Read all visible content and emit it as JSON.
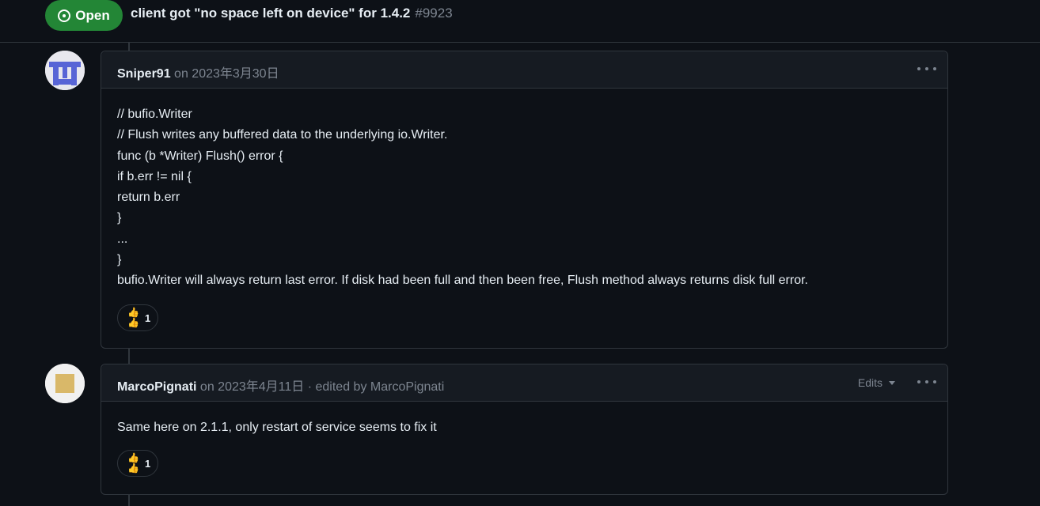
{
  "issue": {
    "state": "Open",
    "title": "client got \"no space left on device\" for 1.4.2",
    "number": "#9923"
  },
  "comments": [
    {
      "author": "Sniper91",
      "date": "on 2023年3月30日",
      "body": [
        "// bufio.Writer",
        "// Flush writes any buffered data to the underlying io.Writer.",
        "func (b *Writer) Flush() error {",
        "if b.err != nil {",
        "return b.err",
        "}",
        "...",
        "}",
        "bufio.Writer will always return last error. If disk had been full and then been free, Flush method always returns disk full error."
      ],
      "reaction": {
        "emoji": "👍",
        "count": "1"
      }
    },
    {
      "author": "MarcoPignati",
      "date": "on 2023年4月11日",
      "edited": "· edited by MarcoPignati",
      "edits_label": "Edits",
      "body": [
        "Same here on 2.1.1, only restart of service seems to fix it"
      ],
      "reaction": {
        "emoji": "👍",
        "count": "1"
      }
    }
  ],
  "colors": {
    "background": "#0d1117",
    "open_badge": "#238636",
    "border": "#30363d",
    "muted_text": "#7d8590",
    "avatar1_blue": "#5865d6",
    "avatar2_tan": "#d9b869"
  }
}
